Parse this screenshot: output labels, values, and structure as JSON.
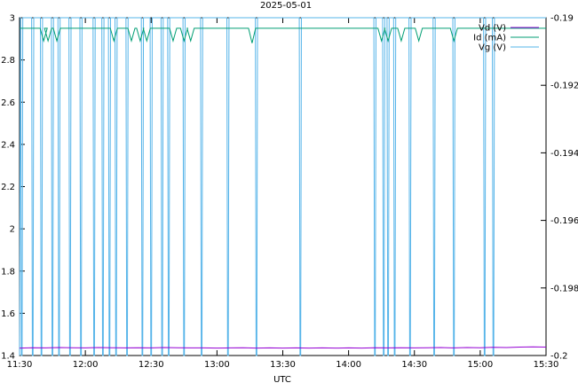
{
  "chart_data": {
    "type": "line",
    "title": "2025-05-01",
    "xlabel": "UTC",
    "ylabel": "",
    "y2label": "",
    "xlim": [
      "11:30",
      "15:30"
    ],
    "ylim": [
      1.4,
      3.0
    ],
    "y2lim": [
      -0.2,
      -0.19
    ],
    "x_ticks": [
      "11:30",
      "12:00",
      "12:30",
      "13:00",
      "13:30",
      "14:00",
      "14:30",
      "15:00",
      "15:30"
    ],
    "y_ticks": [
      "1.4",
      "1.6",
      "1.8",
      "2",
      "2.2",
      "2.4",
      "2.6",
      "2.8",
      "3"
    ],
    "y2_ticks": [
      "-0.2",
      "-0.198",
      "-0.196",
      "-0.194",
      "-0.192",
      "-0.19"
    ],
    "grid": false,
    "legend_position": "top-right",
    "series": [
      {
        "name": "Vd (V)",
        "axis": "y",
        "color": "#9400d3",
        "points": [
          [
            "11:30",
            1.435
          ],
          [
            "11:36",
            1.437
          ],
          [
            "11:42",
            1.436
          ],
          [
            "11:48",
            1.438
          ],
          [
            "11:54",
            1.437
          ],
          [
            "12:00",
            1.436
          ],
          [
            "12:06",
            1.438
          ],
          [
            "12:12",
            1.437
          ],
          [
            "12:18",
            1.436
          ],
          [
            "12:24",
            1.437
          ],
          [
            "12:30",
            1.436
          ],
          [
            "12:36",
            1.438
          ],
          [
            "12:42",
            1.437
          ],
          [
            "12:48",
            1.436
          ],
          [
            "12:54",
            1.436
          ],
          [
            "13:00",
            1.435
          ],
          [
            "13:06",
            1.436
          ],
          [
            "13:12",
            1.437
          ],
          [
            "13:18",
            1.435
          ],
          [
            "13:24",
            1.436
          ],
          [
            "13:30",
            1.435
          ],
          [
            "13:36",
            1.436
          ],
          [
            "13:42",
            1.435
          ],
          [
            "13:48",
            1.436
          ],
          [
            "13:54",
            1.435
          ],
          [
            "14:00",
            1.436
          ],
          [
            "14:06",
            1.435
          ],
          [
            "14:12",
            1.437
          ],
          [
            "14:18",
            1.436
          ],
          [
            "14:24",
            1.437
          ],
          [
            "14:30",
            1.436
          ],
          [
            "14:36",
            1.437
          ],
          [
            "14:42",
            1.438
          ],
          [
            "14:48",
            1.436
          ],
          [
            "14:54",
            1.438
          ],
          [
            "15:00",
            1.437
          ],
          [
            "15:06",
            1.439
          ],
          [
            "15:12",
            1.438
          ],
          [
            "15:18",
            1.44
          ],
          [
            "15:24",
            1.441
          ],
          [
            "15:30",
            1.44
          ]
        ]
      },
      {
        "name": "Id (mA)",
        "axis": "y",
        "color": "#009e73",
        "baseline": 2.95,
        "dips": [
          [
            "11:41",
            2.89
          ],
          [
            "11:43",
            2.89
          ],
          [
            "11:47",
            2.89
          ],
          [
            "12:13",
            2.89
          ],
          [
            "12:21",
            2.89
          ],
          [
            "12:25",
            2.89
          ],
          [
            "12:28",
            2.89
          ],
          [
            "12:40",
            2.89
          ],
          [
            "12:45",
            2.89
          ],
          [
            "12:48",
            2.89
          ],
          [
            "13:16",
            2.88
          ],
          [
            "14:15",
            2.89
          ],
          [
            "14:18",
            2.89
          ],
          [
            "14:24",
            2.89
          ],
          [
            "14:32",
            2.89
          ],
          [
            "14:48",
            2.89
          ]
        ]
      },
      {
        "name": "Vg (V)",
        "axis": "y2",
        "color": "#56b4e9",
        "high": -0.19,
        "low": -0.2,
        "spikes_down": [
          "11:31",
          "11:36",
          "11:40",
          "11:45",
          "11:48",
          "11:53",
          "11:58",
          "12:04",
          "12:08",
          "12:11",
          "12:14",
          "12:19",
          "12:26",
          "12:30",
          "12:35",
          "12:38",
          "12:45",
          "12:53",
          "13:05",
          "13:18",
          "13:38",
          "14:12",
          "14:16",
          "14:18",
          "14:21",
          "14:28",
          "14:39",
          "14:48",
          "15:02",
          "15:06"
        ]
      }
    ]
  }
}
